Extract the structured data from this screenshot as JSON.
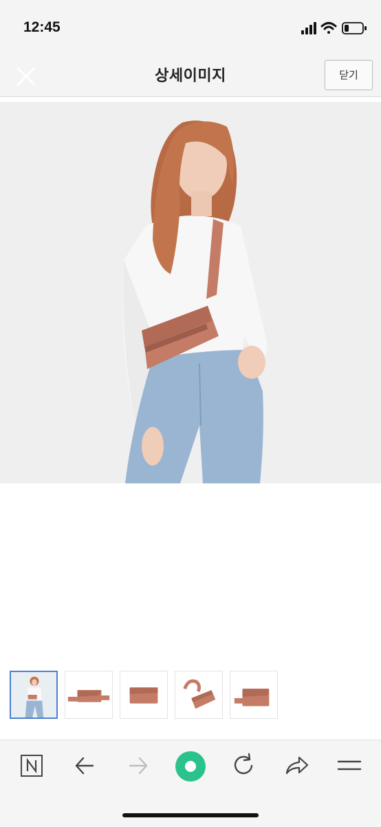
{
  "status_bar": {
    "time": "12:45",
    "battery_level": 0.2
  },
  "nav": {
    "title": "상세이미지",
    "close_button_label": "닫기",
    "close_icon": "close-x-icon"
  },
  "main_image": {
    "description_icon": "product-photo",
    "colors": {
      "bag": "#c47c66",
      "background": "#efefef"
    }
  },
  "thumbnails": [
    {
      "name": "model-wearing-bag",
      "active": true
    },
    {
      "name": "bag-with-strap-flat",
      "active": false
    },
    {
      "name": "bag-front",
      "active": false
    },
    {
      "name": "bag-with-strap-coiled",
      "active": false
    },
    {
      "name": "bag-side-angle",
      "active": false
    }
  ],
  "browser_toolbar": {
    "buttons": [
      "naver-n-icon",
      "back-arrow-icon",
      "forward-arrow-icon",
      "green-circle-home-icon",
      "reload-icon",
      "share-icon",
      "menu-icon"
    ],
    "colors": {
      "accent": "#2bc38b"
    }
  }
}
